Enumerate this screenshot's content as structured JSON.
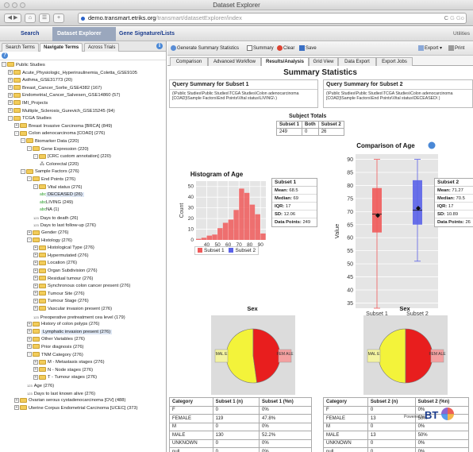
{
  "window": {
    "title": "Dataset Explorer"
  },
  "browser": {
    "host": "demo.transmart.etriks.org",
    "path": "/transmart/datasetExplorer/index",
    "reload": "C",
    "search_placeholder": "G Go"
  },
  "appnav": {
    "items": [
      "Search",
      "Dataset Explorer",
      "Gene Signature/Lists"
    ],
    "active": 1,
    "utilities": "Utilities"
  },
  "left_tabs": [
    "Search Terms",
    "Navigate Terms",
    "Across Trials"
  ],
  "tree": [
    {
      "d": 0,
      "t": "f",
      "e": "-",
      "label": "Public Studies"
    },
    {
      "d": 1,
      "t": "f",
      "e": "+",
      "label": "Acute_Physiologic_Hyperinsulinemia_Coletta_GSE9105"
    },
    {
      "d": 1,
      "t": "f",
      "e": "+",
      "label": "Asthma_GSE31773 (20)"
    },
    {
      "d": 1,
      "t": "f",
      "e": "+",
      "label": "Breast_Cancer_Sorlie_GSE4382 (167)"
    },
    {
      "d": 1,
      "t": "f",
      "e": "+",
      "label": "Endometrial_Cancer_Salvesen_GSE14860 (57)"
    },
    {
      "d": 1,
      "t": "f",
      "e": "+",
      "label": "IMI_Projects"
    },
    {
      "d": 1,
      "t": "f",
      "e": "+",
      "label": "Multiple_Sclerosis_Gurevich_GSE15245 (94)"
    },
    {
      "d": 1,
      "t": "f",
      "e": "-",
      "label": "TCGA Studies"
    },
    {
      "d": 2,
      "t": "f",
      "e": "+",
      "label": "Breast Invasive Carcinoma [BRCA] (849)"
    },
    {
      "d": 2,
      "t": "f",
      "e": "-",
      "label": "Colon adenocarcinoma [COAD] (276)"
    },
    {
      "d": 3,
      "t": "f",
      "e": "-",
      "label": "Biomarker Data (220)"
    },
    {
      "d": 4,
      "t": "f",
      "e": "-",
      "label": "Gene Expression (220)"
    },
    {
      "d": 5,
      "t": "f",
      "e": "-",
      "label": "[CRC custom annotation] (220)"
    },
    {
      "d": 6,
      "t": "h",
      "e": "",
      "label": "Colorectal (220)"
    },
    {
      "d": 3,
      "t": "f",
      "e": "-",
      "label": "Sample Factors (276)"
    },
    {
      "d": 4,
      "t": "f",
      "e": "-",
      "label": "End Points (276)"
    },
    {
      "d": 5,
      "t": "f",
      "e": "-",
      "label": "Vital status (276)"
    },
    {
      "d": 6,
      "t": "g",
      "e": "",
      "label": "DECEASED (26)",
      "sel": true
    },
    {
      "d": 6,
      "t": "g",
      "e": "",
      "label": "LIVING (249)"
    },
    {
      "d": 6,
      "t": "g",
      "e": "",
      "label": "NA (1)"
    },
    {
      "d": 5,
      "t": "n",
      "e": "",
      "label": "Days to death (26)"
    },
    {
      "d": 5,
      "t": "n",
      "e": "",
      "label": "Days to last follow-up (276)"
    },
    {
      "d": 4,
      "t": "f",
      "e": "+",
      "label": "Gender (276)"
    },
    {
      "d": 4,
      "t": "f",
      "e": "-",
      "label": "Histology (276)"
    },
    {
      "d": 5,
      "t": "f",
      "e": "+",
      "label": "Histological Type (276)"
    },
    {
      "d": 5,
      "t": "f",
      "e": "+",
      "label": "Hypermutated (276)"
    },
    {
      "d": 5,
      "t": "f",
      "e": "+",
      "label": "Location (276)"
    },
    {
      "d": 5,
      "t": "f",
      "e": "+",
      "label": "Organ Subdivision (276)"
    },
    {
      "d": 5,
      "t": "f",
      "e": "+",
      "label": "Residual tumour (276)"
    },
    {
      "d": 5,
      "t": "f",
      "e": "+",
      "label": "Synchronous colon cancer present (276)"
    },
    {
      "d": 5,
      "t": "f",
      "e": "+",
      "label": "Tumour Site (276)"
    },
    {
      "d": 5,
      "t": "f",
      "e": "+",
      "label": "Tumour Stage (276)"
    },
    {
      "d": 5,
      "t": "f",
      "e": "+",
      "label": "Vascular invasion present (276)"
    },
    {
      "d": 5,
      "t": "n",
      "e": "",
      "label": "Preoperative pretreatment cea level (179)"
    },
    {
      "d": 4,
      "t": "f",
      "e": "+",
      "label": "History of colon polyps (276)"
    },
    {
      "d": 4,
      "t": "f",
      "e": "+",
      "label": "Lymphatic invasion present (276)",
      "sel": true
    },
    {
      "d": 4,
      "t": "f",
      "e": "+",
      "label": "Other Variables (276)"
    },
    {
      "d": 4,
      "t": "f",
      "e": "+",
      "label": "Prior diagnosis (276)"
    },
    {
      "d": 4,
      "t": "f",
      "e": "-",
      "label": "TNM Category (276)"
    },
    {
      "d": 5,
      "t": "f",
      "e": "+",
      "label": "M - Metastasis stages (276)"
    },
    {
      "d": 5,
      "t": "f",
      "e": "+",
      "label": "N - Node stages (276)"
    },
    {
      "d": 5,
      "t": "f",
      "e": "+",
      "label": "T - Tumour stages (276)"
    },
    {
      "d": 4,
      "t": "n",
      "e": "",
      "label": "Age (276)"
    },
    {
      "d": 4,
      "t": "n",
      "e": "",
      "label": "Days to last known alive (276)"
    },
    {
      "d": 2,
      "t": "f",
      "e": "+",
      "label": "Ovarian serous cystadenocarcinoma [OV] (488)"
    },
    {
      "d": 2,
      "t": "f",
      "e": "+",
      "label": "Uterine Corpus Endometrial Carcinoma [UCEC] (373)"
    }
  ],
  "right_toolbar": {
    "generate": "Generate Summary Statistics",
    "summary": "Summary",
    "clear": "Clear",
    "save": "Save",
    "export": "Export",
    "print": "Print"
  },
  "right_tabs": [
    "Comparison",
    "Advanced Workflow",
    "Results/Analysis",
    "Grid View",
    "Data Export",
    "Export Jobs"
  ],
  "right_tabs_active": 2,
  "summary": {
    "title": "Summary Statistics",
    "query1": {
      "head": "Query Summary for Subset 1",
      "body": "(\\Public Studies\\Public Studies\\TCGA Studies\\Colon adenocarcinoma [COAD]\\Sample Factors\\End Points\\Vital status\\LIVING\\ )"
    },
    "query2": {
      "head": "Query Summary for Subset 2",
      "body": "(\\Public Studies\\Public Studies\\TCGA Studies\\Colon adenocarcinoma [COAD]\\Sample Factors\\End Points\\Vital status\\DECEASED\\ )"
    },
    "totals": {
      "title": "Subject Totals",
      "headers": [
        "Subset 1",
        "Both",
        "Subset 2"
      ],
      "values": [
        "249",
        "0",
        "26"
      ]
    }
  },
  "hist": {
    "title": "Histogram of Age",
    "ylabel": "Count",
    "yticks": [
      "0",
      "10",
      "20",
      "30",
      "40",
      "50"
    ],
    "xticks": [
      "40",
      "50",
      "60",
      "70",
      "80",
      "90"
    ],
    "legend": [
      "Subset 1",
      "Subset 2"
    ]
  },
  "stats1": {
    "head": "Subset 1",
    "rows": [
      [
        "Mean:",
        "68.5"
      ],
      [
        "Median:",
        "69"
      ],
      [
        "IQR:",
        "17"
      ],
      [
        "SD:",
        "12.06"
      ],
      [
        "Data Points:",
        "249"
      ]
    ]
  },
  "stats2": {
    "head": "Subset 2",
    "rows": [
      [
        "Mean:",
        "71.27"
      ],
      [
        "Median:",
        "70.5"
      ],
      [
        "IQR:",
        "17"
      ],
      [
        "SD:",
        "10.89"
      ],
      [
        "Data Points:",
        "26"
      ]
    ]
  },
  "box": {
    "title": "Comparison of Age",
    "ylabel": "Value",
    "yticks": [
      "35",
      "40",
      "45",
      "50",
      "55",
      "60",
      "65",
      "70",
      "75",
      "80",
      "85",
      "90"
    ],
    "xcats": [
      "Subset 1",
      "Subset 2"
    ]
  },
  "pies": {
    "title": "Sex",
    "labels": [
      "MAL E",
      "FEM ALE"
    ]
  },
  "cat1": {
    "headers": [
      "Category",
      "Subset 1 (n)",
      "Subset 1 (%n)"
    ],
    "rows": [
      [
        "F",
        "0",
        "0%"
      ],
      [
        "FEMALE",
        "119",
        "47.8%"
      ],
      [
        "M",
        "0",
        "0%"
      ],
      [
        "MALE",
        "130",
        "52.2%"
      ],
      [
        "UNKNOWN",
        "0",
        "0%"
      ],
      [
        "null",
        "0",
        "0%"
      ]
    ]
  },
  "cat2": {
    "headers": [
      "Category",
      "Subset 2 (n)",
      "Subset 2 (%n)"
    ],
    "rows": [
      [
        "F",
        "0",
        "0%"
      ],
      [
        "FEMALE",
        "13",
        "50%"
      ],
      [
        "M",
        "0",
        "0%"
      ],
      [
        "MALE",
        "13",
        "50%"
      ],
      [
        "UNKNOWN",
        "0",
        "0%"
      ],
      [
        "null",
        "0",
        "0%"
      ]
    ]
  },
  "branding": {
    "powered": "Powered by",
    "logo": "BT"
  },
  "colors": {
    "subset1": "#f05a5a",
    "subset2": "#5a62e8",
    "pie_red": "#e81e1e",
    "pie_yellow": "#f3f33a",
    "nav_blue": "#1a3b8c"
  },
  "chart_data": [
    {
      "type": "bar",
      "title": "Histogram of Age",
      "xlabel": "",
      "ylabel": "Count",
      "x": [
        30,
        35,
        40,
        45,
        50,
        55,
        60,
        65,
        70,
        75,
        80,
        85,
        90
      ],
      "series": [
        {
          "name": "Subset 1",
          "values": [
            1,
            2,
            4,
            5,
            11,
            16,
            19,
            28,
            48,
            44,
            33,
            24,
            6
          ]
        }
      ],
      "ylim": [
        0,
        55
      ],
      "xlim": [
        30,
        95
      ]
    },
    {
      "type": "box",
      "title": "Comparison of Age",
      "ylabel": "Value",
      "categories": [
        "Subset 1",
        "Subset 2"
      ],
      "series": [
        {
          "name": "Subset 1",
          "min": 33,
          "q1": 62,
          "median": 69,
          "q3": 79,
          "max": 90,
          "mean": 68.5
        },
        {
          "name": "Subset 2",
          "min": 51,
          "q1": 65,
          "median": 70.5,
          "q3": 82,
          "max": 90,
          "mean": 71.27
        }
      ],
      "ylim": [
        33,
        92
      ]
    },
    {
      "type": "pie",
      "title": "Sex",
      "categories": [
        "MALE",
        "FEMALE"
      ],
      "values": [
        52.2,
        47.8
      ]
    },
    {
      "type": "pie",
      "title": "Sex",
      "categories": [
        "MALE",
        "FEMALE"
      ],
      "values": [
        50,
        50
      ]
    }
  ]
}
